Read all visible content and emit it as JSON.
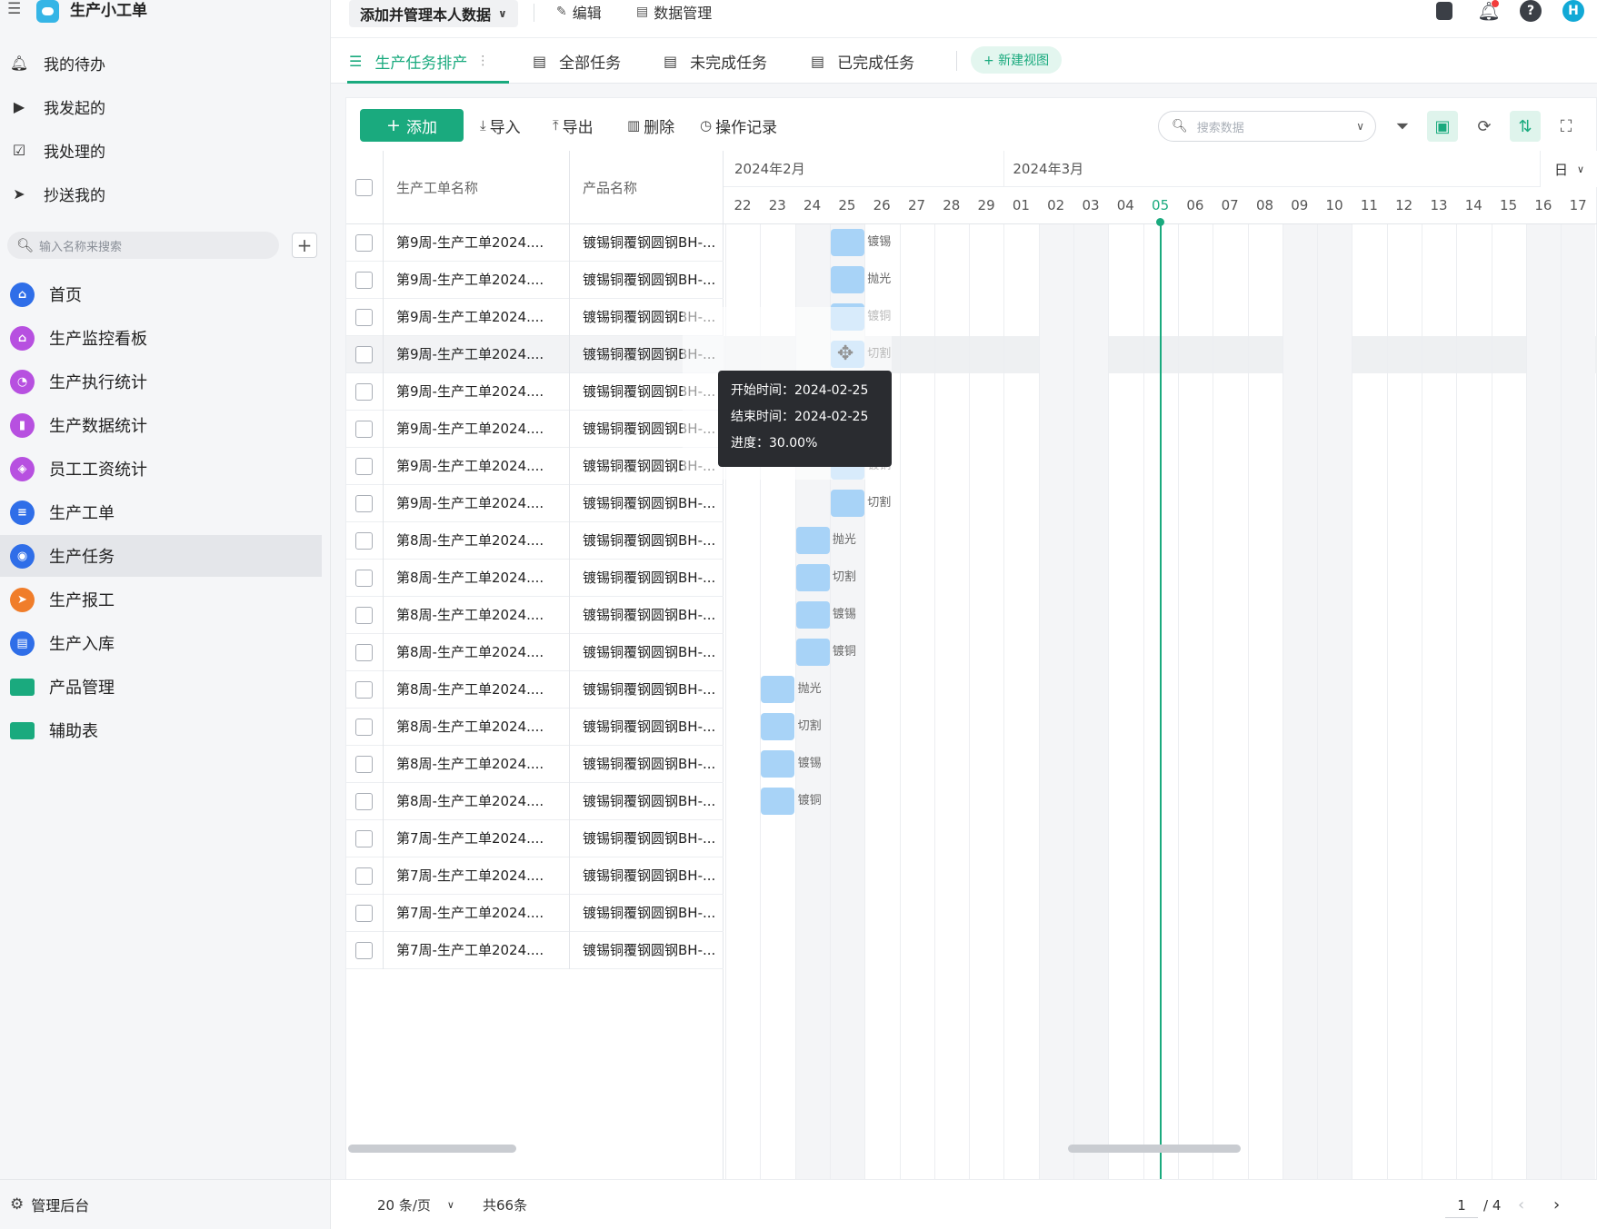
{
  "app": {
    "name": "生产小工单"
  },
  "sidebar": {
    "quick": [
      {
        "label": "我的待办",
        "icon": "bell-icon"
      },
      {
        "label": "我发起的",
        "icon": "play-circle-icon"
      },
      {
        "label": "我处理的",
        "icon": "check-box-icon"
      },
      {
        "label": "抄送我的",
        "icon": "send-icon"
      }
    ],
    "search_placeholder": "输入名称来搜索",
    "nav": [
      {
        "label": "首页",
        "icon": "home-icon",
        "color": "#2f6ee8"
      },
      {
        "label": "生产监控看板",
        "icon": "home-icon",
        "color": "#b750e0"
      },
      {
        "label": "生产执行统计",
        "icon": "pie-icon",
        "color": "#b750e0"
      },
      {
        "label": "生产数据统计",
        "icon": "bar-chart-icon",
        "color": "#b750e0"
      },
      {
        "label": "员工工资统计",
        "icon": "wallet-icon",
        "color": "#b750e0"
      },
      {
        "label": "生产工单",
        "icon": "document-icon",
        "color": "#2f6ee8"
      },
      {
        "label": "生产任务",
        "icon": "task-icon",
        "color": "#2f6ee8",
        "active": true
      },
      {
        "label": "生产报工",
        "icon": "send-icon",
        "color": "#f07d2a"
      },
      {
        "label": "生产入库",
        "icon": "clipboard-icon",
        "color": "#2f6ee8"
      },
      {
        "label": "产品管理",
        "icon": "folder-icon",
        "color": "#1aaa7e"
      },
      {
        "label": "辅助表",
        "icon": "folder-icon",
        "color": "#1aaa7e"
      }
    ],
    "admin_label": "管理后台"
  },
  "topbar": {
    "view_selector": "添加并管理本人数据",
    "edit_label": "编辑",
    "data_manage_label": "数据管理",
    "avatar_letter": "H"
  },
  "tabs": [
    {
      "label": "生产任务排产",
      "active": true
    },
    {
      "label": "全部任务"
    },
    {
      "label": "未完成任务"
    },
    {
      "label": "已完成任务"
    }
  ],
  "new_view_label": "+ 新建视图",
  "toolbar": {
    "add_label": "添加",
    "import_label": "导入",
    "export_label": "导出",
    "delete_label": "删除",
    "log_label": "操作记录",
    "search_placeholder": "搜索数据"
  },
  "table": {
    "columns": [
      "生产工单名称",
      "产品名称"
    ],
    "rows": [
      {
        "name": "第9周-生产工单2024....",
        "product": "镀锡铜覆钢圆钢BH-..."
      },
      {
        "name": "第9周-生产工单2024....",
        "product": "镀锡铜覆钢圆钢BH-..."
      },
      {
        "name": "第9周-生产工单2024....",
        "product": "镀锡铜覆钢圆钢BH-..."
      },
      {
        "name": "第9周-生产工单2024....",
        "product": "镀锡铜覆钢圆钢BH-..."
      },
      {
        "name": "第9周-生产工单2024....",
        "product": "镀锡铜覆钢圆钢BH-..."
      },
      {
        "name": "第9周-生产工单2024....",
        "product": "镀锡铜覆钢圆钢BH-..."
      },
      {
        "name": "第9周-生产工单2024....",
        "product": "镀锡铜覆钢圆钢BH-..."
      },
      {
        "name": "第9周-生产工单2024....",
        "product": "镀锡铜覆钢圆钢BH-..."
      },
      {
        "name": "第8周-生产工单2024....",
        "product": "镀锡铜覆钢圆钢BH-..."
      },
      {
        "name": "第8周-生产工单2024....",
        "product": "镀锡铜覆钢圆钢BH-..."
      },
      {
        "name": "第8周-生产工单2024....",
        "product": "镀锡铜覆钢圆钢BH-..."
      },
      {
        "name": "第8周-生产工单2024....",
        "product": "镀锡铜覆钢圆钢BH-..."
      },
      {
        "name": "第8周-生产工单2024....",
        "product": "镀锡铜覆钢圆钢BH-..."
      },
      {
        "name": "第8周-生产工单2024....",
        "product": "镀锡铜覆钢圆钢BH-..."
      },
      {
        "name": "第8周-生产工单2024....",
        "product": "镀锡铜覆钢圆钢BH-..."
      },
      {
        "name": "第8周-生产工单2024....",
        "product": "镀锡铜覆钢圆钢BH-..."
      },
      {
        "name": "第7周-生产工单2024....",
        "product": "镀锡铜覆钢圆钢BH-..."
      },
      {
        "name": "第7周-生产工单2024....",
        "product": "镀锡铜覆钢圆钢BH-..."
      },
      {
        "name": "第7周-生产工单2024....",
        "product": "镀锡铜覆钢圆钢BH-..."
      },
      {
        "name": "第7周-生产工单2024....",
        "product": "镀锡铜覆钢圆钢BH-..."
      }
    ]
  },
  "gantt": {
    "months": [
      "2024年2月",
      "2024年3月"
    ],
    "days": [
      "22",
      "23",
      "24",
      "25",
      "26",
      "27",
      "28",
      "29",
      "01",
      "02",
      "03",
      "04",
      "05",
      "06",
      "07",
      "08",
      "09",
      "10",
      "11",
      "12",
      "13",
      "14",
      "15",
      "16",
      "17"
    ],
    "today": "05",
    "unit_label": "日",
    "tasks": [
      {
        "row": 0,
        "day": "25",
        "label": "镀锡"
      },
      {
        "row": 1,
        "day": "25",
        "label": "抛光"
      },
      {
        "row": 2,
        "day": "25",
        "label": "镀铜"
      },
      {
        "row": 3,
        "day": "25",
        "label": "切割"
      },
      {
        "row": 4,
        "day": "25",
        "label": ""
      },
      {
        "row": 5,
        "day": "25",
        "label": ""
      },
      {
        "row": 6,
        "day": "25",
        "label": "镀铜"
      },
      {
        "row": 7,
        "day": "25",
        "label": "切割"
      },
      {
        "row": 8,
        "day": "24",
        "label": "抛光"
      },
      {
        "row": 9,
        "day": "24",
        "label": "切割"
      },
      {
        "row": 10,
        "day": "24",
        "label": "镀锡"
      },
      {
        "row": 11,
        "day": "24",
        "label": "镀铜"
      },
      {
        "row": 12,
        "day": "23",
        "label": "抛光"
      },
      {
        "row": 13,
        "day": "23",
        "label": "切割"
      },
      {
        "row": 14,
        "day": "23",
        "label": "镀锡"
      },
      {
        "row": 15,
        "day": "23",
        "label": "镀铜"
      }
    ],
    "tooltip": {
      "start": "开始时间：2024-02-25",
      "end": "结束时间：2024-02-25",
      "progress": "进度：30.00%"
    }
  },
  "footer": {
    "page_size": "20 条/页",
    "total": "共66条",
    "current_page": "1",
    "total_pages": "/ 4"
  },
  "colors": {
    "accent": "#1aaa7e",
    "bar": "#a8d3f7"
  }
}
